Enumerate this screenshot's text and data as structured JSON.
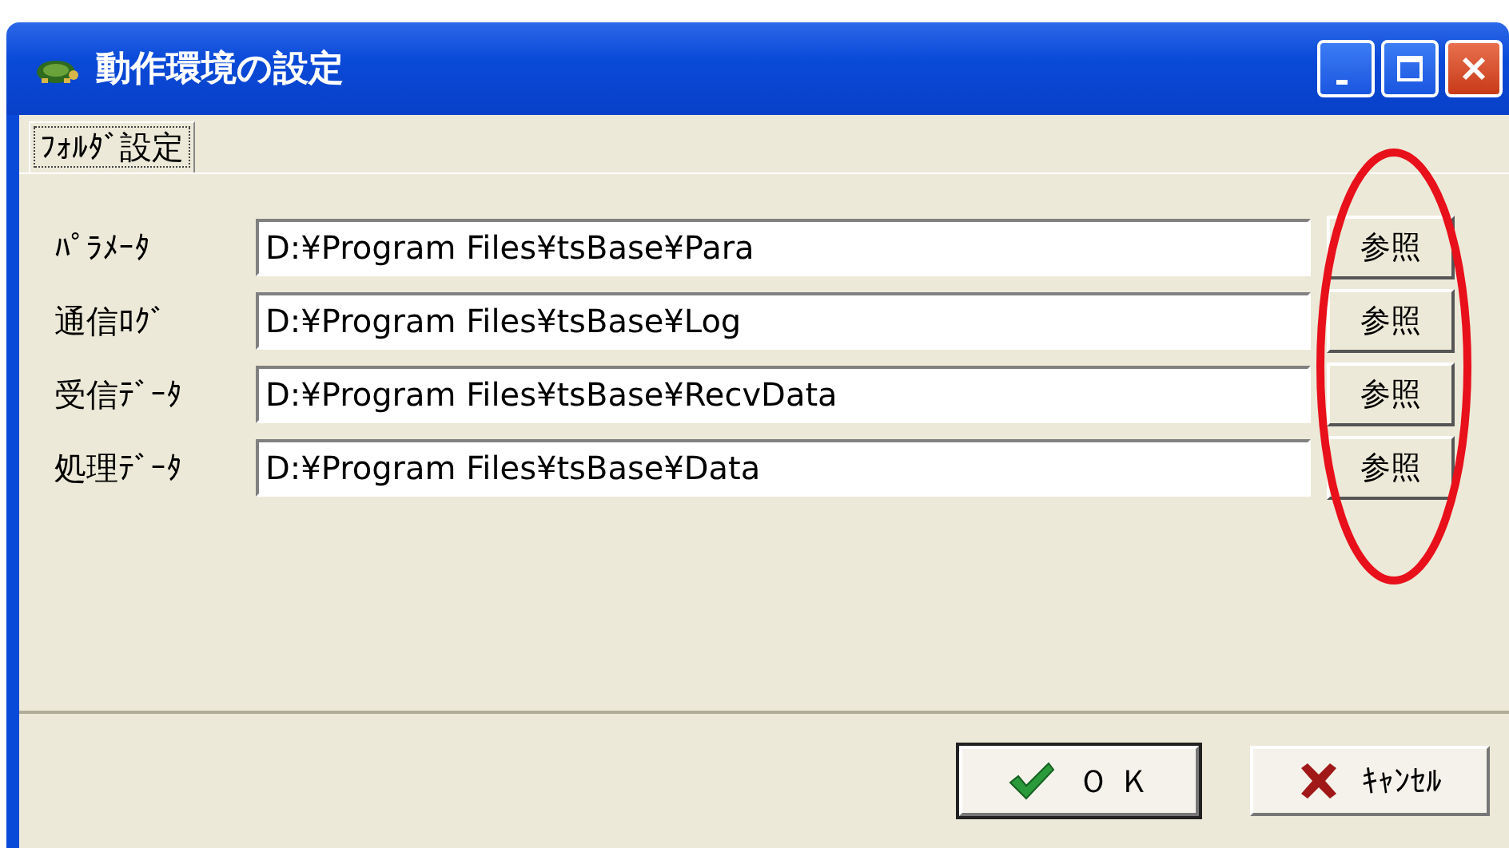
{
  "window": {
    "title": "動作環境の設定"
  },
  "tabs": [
    {
      "label": "ﾌｫﾙﾀﾞ設定",
      "selected": true
    }
  ],
  "folders": [
    {
      "label": "ﾊﾟﾗﾒｰﾀ",
      "value": "D:¥Program Files¥tsBase¥Para",
      "button": "参照"
    },
    {
      "label": "通信ﾛｸﾞ",
      "value": "D:¥Program Files¥tsBase¥Log",
      "button": "参照"
    },
    {
      "label": "受信ﾃﾞｰﾀ",
      "value": "D:¥Program Files¥tsBase¥RecvData",
      "button": "参照"
    },
    {
      "label": "処理ﾃﾞｰﾀ",
      "value": "D:¥Program Files¥tsBase¥Data",
      "button": "参照"
    }
  ],
  "buttons": [
    {
      "kind": "ok",
      "label": "Ｏ Ｋ"
    },
    {
      "kind": "cancel",
      "label": "ｷｬﾝｾﾙ"
    }
  ]
}
